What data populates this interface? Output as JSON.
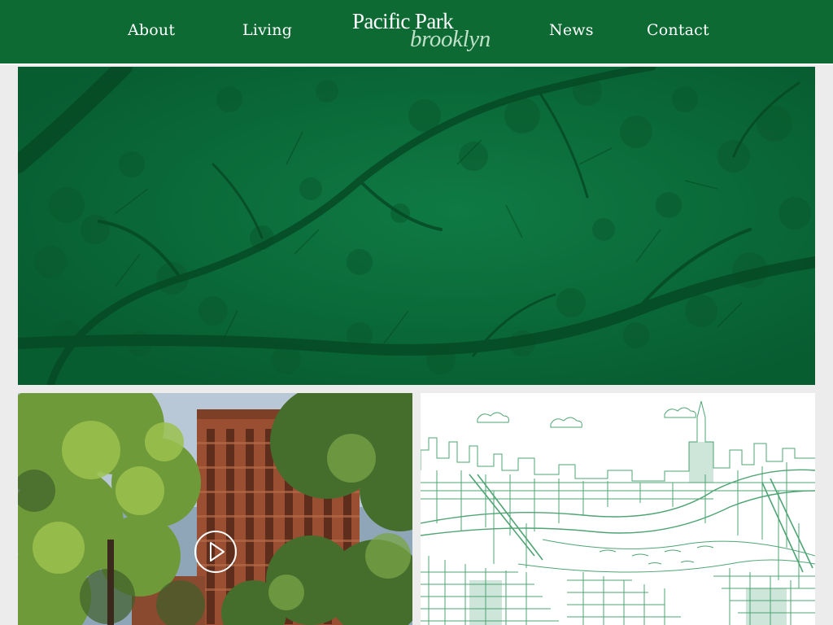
{
  "nav": {
    "items": [
      {
        "label": "About"
      },
      {
        "label": "Living"
      },
      {
        "label": "News"
      },
      {
        "label": "Contact"
      }
    ]
  },
  "logo": {
    "line1": "Pacific Park",
    "line2": "brooklyn"
  },
  "hero": {
    "image": "green-tinted-tree-canopy"
  },
  "tiles": {
    "left": {
      "image": "residential-tower-behind-trees",
      "icon": "play-icon"
    },
    "right": {
      "image": "illustrated-nyc-skyline-map"
    }
  },
  "colors": {
    "header": "#0d6a33",
    "hero_tint": "#0b6a3a",
    "illustration_ink": "#3c9b66",
    "background": "#ececec"
  }
}
